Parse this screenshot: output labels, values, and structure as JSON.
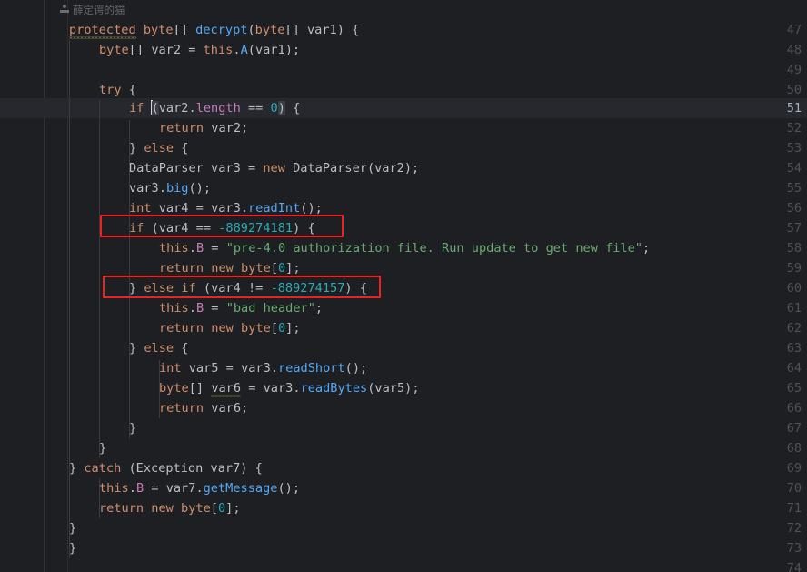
{
  "editor": {
    "theme_background": "#1e1f22",
    "current_line_background": "#26282e",
    "current_line_number": 51,
    "gutter_separator_color": "#303338",
    "annotation_highlight_color": "#ee2222",
    "first_visible_line": 47,
    "last_visible_line": 74
  },
  "annotation": {
    "author_icon": "person-icon",
    "author_text": "薛定谔的猫"
  },
  "line_numbers": [
    47,
    48,
    49,
    50,
    51,
    52,
    53,
    54,
    55,
    56,
    57,
    58,
    59,
    60,
    61,
    62,
    63,
    64,
    65,
    66,
    67,
    68,
    69,
    70,
    71,
    72,
    73,
    74
  ],
  "code": {
    "l47": "protected byte[] decrypt(byte[] var1) {",
    "l48": "byte[] var2 = this.A(var1);",
    "l49": "",
    "l50": "try {",
    "l51": "if (var2.length == 0) {",
    "l52": "return var2;",
    "l53": "} else {",
    "l54": "DataParser var3 = new DataParser(var2);",
    "l55": "var3.big();",
    "l56": "int var4 = var3.readInt();",
    "l57": "if (var4 == -889274181) {",
    "l58": "this.B = \"pre-4.0 authorization file. Run update to get new file\";",
    "l59": "return new byte[0];",
    "l60": "} else if (var4 != -889274157) {",
    "l61": "this.B = \"bad header\";",
    "l62": "return new byte[0];",
    "l63": "} else {",
    "l64": "int var5 = var3.readShort();",
    "l65": "byte[] var6 = var3.readBytes(var5);",
    "l66": "return var6;",
    "l67": "}",
    "l68": "}",
    "l69": "} catch (Exception var7) {",
    "l70": "this.B = var7.getMessage();",
    "l71": "return new byte[0];",
    "l72": "}",
    "l73": "}",
    "l74": ""
  },
  "tokens": {
    "kw_protected": "protected",
    "kw_byte": "byte",
    "kw_int": "int",
    "kw_new": "new",
    "kw_try": "try",
    "kw_catch": "catch",
    "kw_if": "if",
    "kw_else": "else",
    "kw_return": "return",
    "kw_this": "this",
    "method_decrypt": "decrypt",
    "method_A": "A",
    "method_big": "big",
    "method_readInt": "readInt",
    "method_readShort": "readShort",
    "method_readBytes": "readBytes",
    "method_getMessage": "getMessage",
    "type_DataParser": "DataParser",
    "type_Exception": "Exception",
    "field_length": "length",
    "field_B": "B",
    "var1": "var1",
    "var2": "var2",
    "var3": "var3",
    "var4": "var4",
    "var5": "var5",
    "var6": "var6",
    "var7": "var7",
    "num_zero": "0",
    "magic_1": "-889274181",
    "magic_2": "-889274157",
    "string_pre40": "\"pre-4.0 authorization file. Run update to get new file\"",
    "string_bad_header": "\"bad header\""
  },
  "highlight_boxes": [
    {
      "label": "magic-number-check-1",
      "line": 57,
      "text": "if (var4 == -889274181) {"
    },
    {
      "label": "magic-number-check-2",
      "line": 60,
      "text": "} else if (var4 != -889274157) {"
    }
  ],
  "colors": {
    "keyword": "#cf8e6d",
    "method": "#56a8f5",
    "field": "#c77dbb",
    "number": "#2aacb8",
    "string": "#6aab73",
    "plain": "#bcbec4",
    "line_number": "#4f5259",
    "line_number_active": "#a9b0bb",
    "warning_squiggle": "#b3ae60"
  }
}
